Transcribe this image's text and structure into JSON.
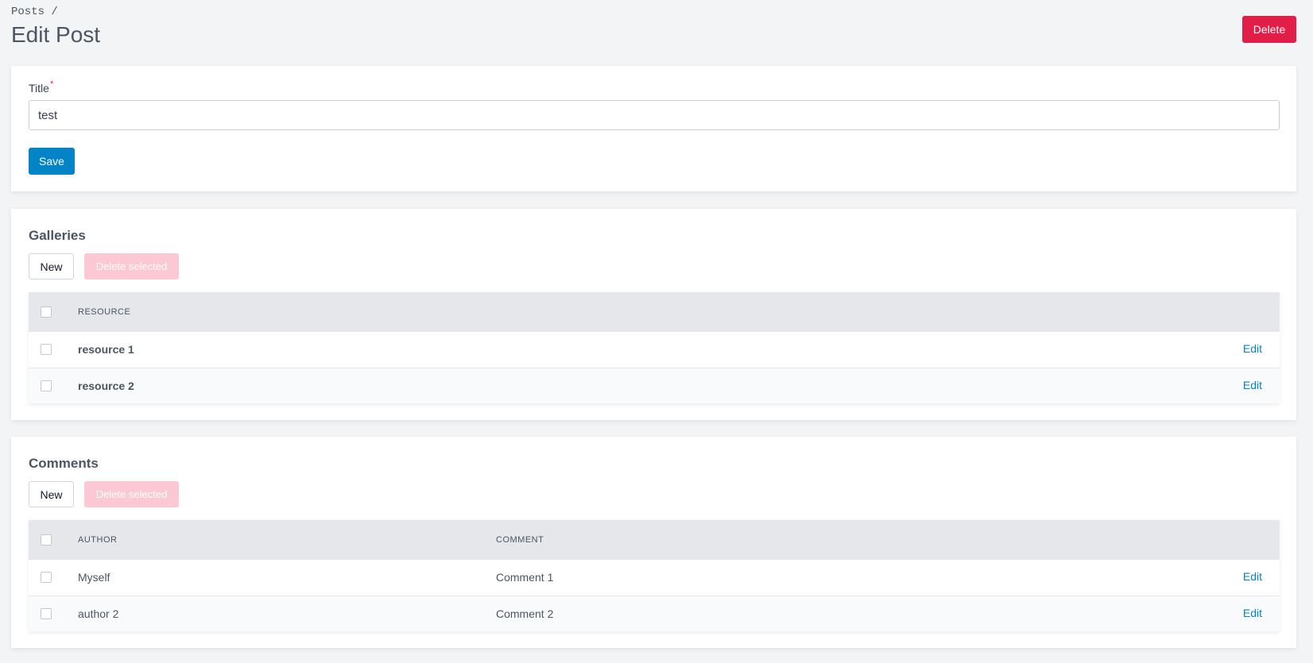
{
  "breadcrumb": {
    "parent": "Posts",
    "separator": "/"
  },
  "header": {
    "title": "Edit Post",
    "delete_label": "Delete"
  },
  "form": {
    "title_label": "Title",
    "required_mark": "*",
    "title_value": "test",
    "save_label": "Save"
  },
  "galleries": {
    "title": "Galleries",
    "new_label": "New",
    "delete_selected_label": "Delete selected",
    "columns": [
      "Resource"
    ],
    "rows": [
      {
        "resource": "resource 1",
        "action": "Edit"
      },
      {
        "resource": "resource 2",
        "action": "Edit"
      }
    ]
  },
  "comments": {
    "title": "Comments",
    "new_label": "New",
    "delete_selected_label": "Delete selected",
    "columns": [
      "Author",
      "Comment"
    ],
    "rows": [
      {
        "author": "Myself",
        "comment": "Comment 1",
        "action": "Edit"
      },
      {
        "author": "author 2",
        "comment": "Comment 2",
        "action": "Edit"
      }
    ]
  },
  "colors": {
    "danger": "#e11d48",
    "primary": "#0284c7",
    "danger_disabled": "#fbc8d3"
  }
}
